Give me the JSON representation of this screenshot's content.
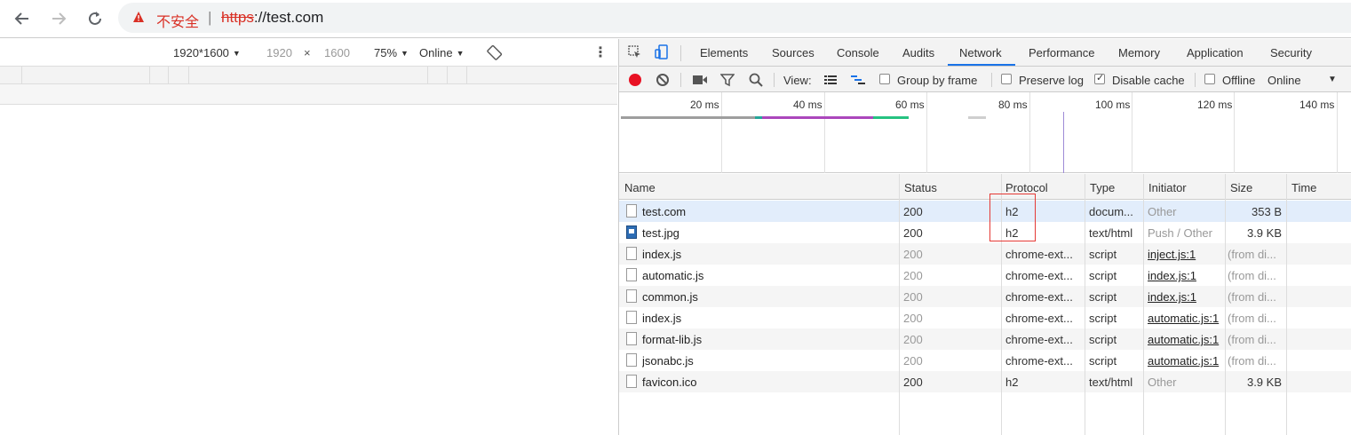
{
  "browser": {
    "insecure_label": "不安全",
    "separator": "|",
    "url_scheme": "https",
    "url_rest": "://test.com"
  },
  "device_toolbar": {
    "dimensions_preset": "1920*1600",
    "width": "1920",
    "times": "×",
    "height": "1600",
    "zoom": "75%",
    "throttle": "Online"
  },
  "devtools": {
    "tabs": [
      "Elements",
      "Sources",
      "Console",
      "Audits",
      "Network",
      "Performance",
      "Memory",
      "Application",
      "Security"
    ],
    "active_tab": "Network",
    "toolbar": {
      "view_label": "View:",
      "group_by_frame": "Group by frame",
      "preserve_log": "Preserve log",
      "disable_cache": "Disable cache",
      "offline": "Offline",
      "throttle": "Online",
      "group_by_frame_checked": false,
      "preserve_log_checked": false,
      "disable_cache_checked": true,
      "offline_checked": false
    },
    "overview_ticks": [
      "20 ms",
      "40 ms",
      "60 ms",
      "80 ms",
      "100 ms",
      "120 ms",
      "140 ms"
    ],
    "columns": [
      "Name",
      "Status",
      "Protocol",
      "Type",
      "Initiator",
      "Size",
      "Time"
    ],
    "rows": [
      {
        "name": "test.com",
        "status": "200",
        "protocol": "h2",
        "type": "docum...",
        "initiator": "Other",
        "size": "353 B",
        "icon": "document",
        "selected": true,
        "dim": false,
        "initiator_link": false,
        "initiator_dim": true
      },
      {
        "name": "test.jpg",
        "status": "200",
        "protocol": "h2",
        "type": "text/html",
        "initiator": "Push / Other",
        "size": "3.9 KB",
        "icon": "image",
        "selected": false,
        "dim": false,
        "initiator_link": false,
        "initiator_dim": true
      },
      {
        "name": "index.js",
        "status": "200",
        "protocol": "chrome-ext...",
        "type": "script",
        "initiator": "inject.js:1",
        "size": "(from di...",
        "icon": "document",
        "selected": false,
        "dim": true,
        "initiator_link": true,
        "initiator_dim": false
      },
      {
        "name": "automatic.js",
        "status": "200",
        "protocol": "chrome-ext...",
        "type": "script",
        "initiator": "index.js:1",
        "size": "(from di...",
        "icon": "document",
        "selected": false,
        "dim": true,
        "initiator_link": true,
        "initiator_dim": false
      },
      {
        "name": "common.js",
        "status": "200",
        "protocol": "chrome-ext...",
        "type": "script",
        "initiator": "index.js:1",
        "size": "(from di...",
        "icon": "document",
        "selected": false,
        "dim": true,
        "initiator_link": true,
        "initiator_dim": false
      },
      {
        "name": "index.js",
        "status": "200",
        "protocol": "chrome-ext...",
        "type": "script",
        "initiator": "automatic.js:1",
        "size": "(from di...",
        "icon": "document",
        "selected": false,
        "dim": true,
        "initiator_link": true,
        "initiator_dim": false
      },
      {
        "name": "format-lib.js",
        "status": "200",
        "protocol": "chrome-ext...",
        "type": "script",
        "initiator": "automatic.js:1",
        "size": "(from di...",
        "icon": "document",
        "selected": false,
        "dim": true,
        "initiator_link": true,
        "initiator_dim": false
      },
      {
        "name": "jsonabc.js",
        "status": "200",
        "protocol": "chrome-ext...",
        "type": "script",
        "initiator": "automatic.js:1",
        "size": "(from di...",
        "icon": "document",
        "selected": false,
        "dim": true,
        "initiator_link": true,
        "initiator_dim": false
      },
      {
        "name": "favicon.ico",
        "status": "200",
        "protocol": "h2",
        "type": "text/html",
        "initiator": "Other",
        "size": "3.9 KB",
        "icon": "document",
        "selected": false,
        "dim": false,
        "initiator_link": false,
        "initiator_dim": true
      }
    ]
  },
  "colors": {
    "insecure_red": "#d93025",
    "record_red": "#e81123",
    "active_tab_underline": "#1a73e8",
    "selected_row": "#e2edfb",
    "highlight_box": "#e53935"
  }
}
